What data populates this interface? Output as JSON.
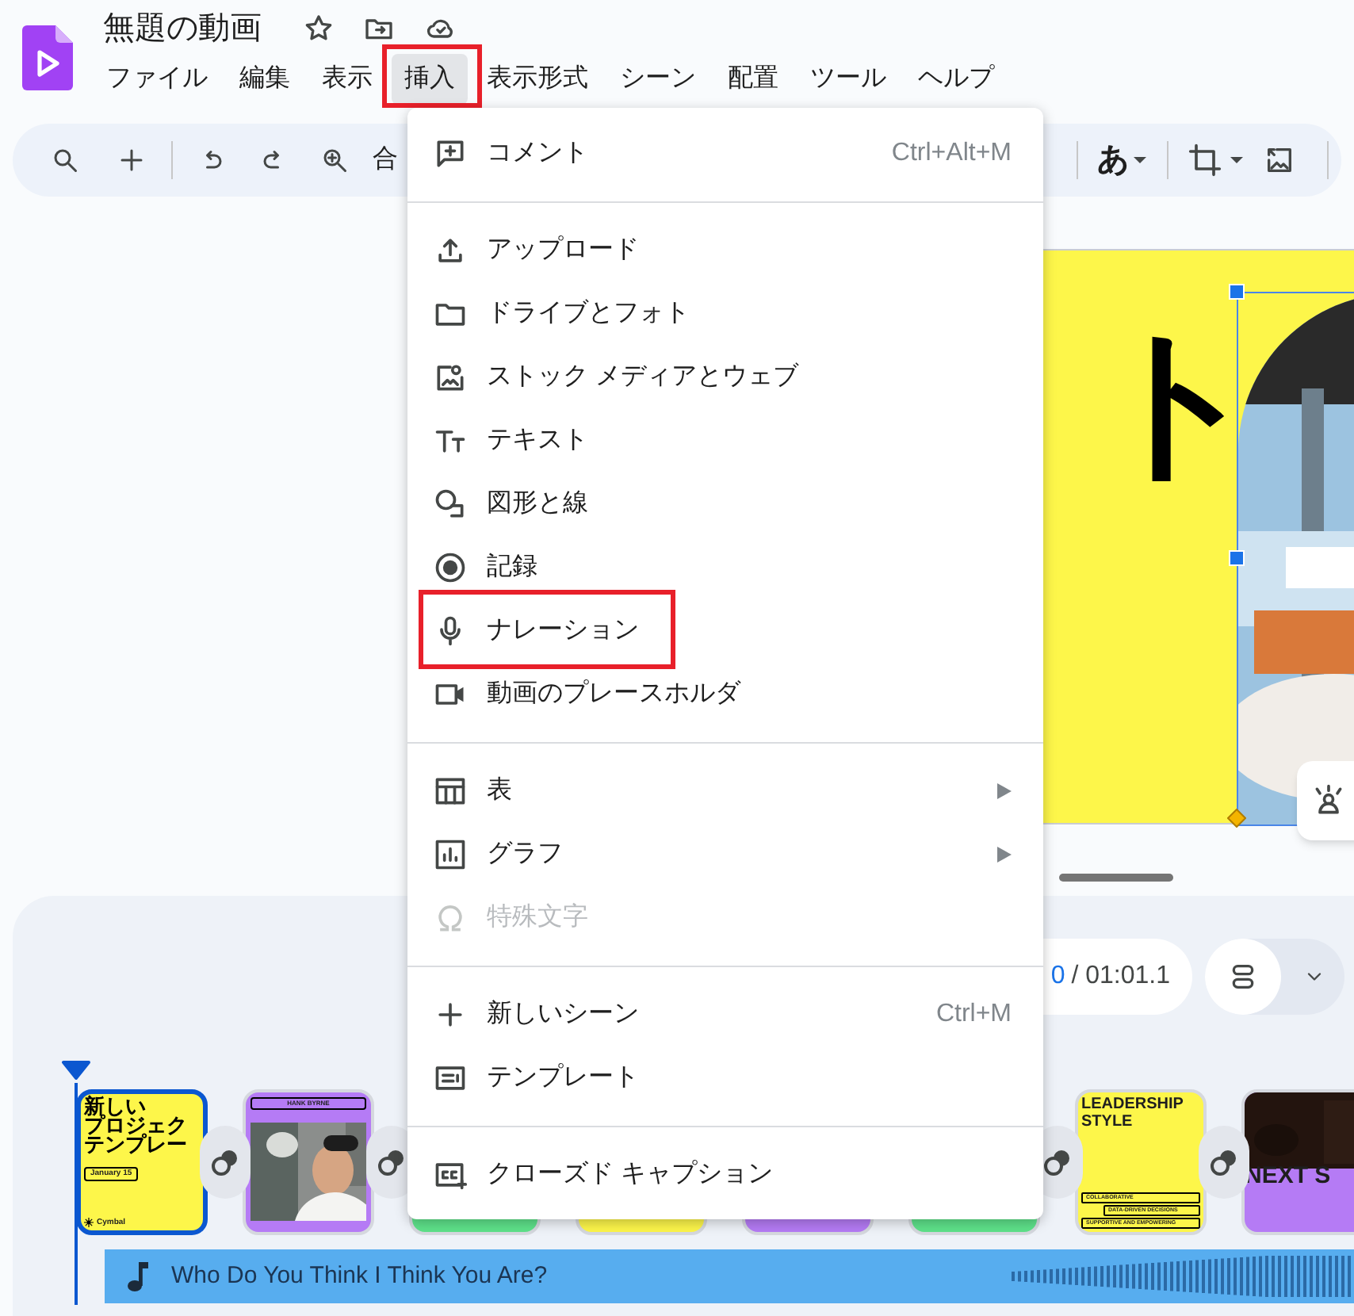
{
  "app": {
    "title": "無題の動画"
  },
  "menu_bar": [
    {
      "label": "ファイル",
      "selected": false,
      "highlighted": false
    },
    {
      "label": "編集",
      "selected": false,
      "highlighted": false
    },
    {
      "label": "表示",
      "selected": false,
      "highlighted": false
    },
    {
      "label": "挿入",
      "selected": true,
      "highlighted": true
    },
    {
      "label": "表示形式",
      "selected": false,
      "highlighted": false
    },
    {
      "label": "シーン",
      "selected": false,
      "highlighted": false
    },
    {
      "label": "配置",
      "selected": false,
      "highlighted": false
    },
    {
      "label": "ツール",
      "selected": false,
      "highlighted": false
    },
    {
      "label": "ヘルプ",
      "selected": false,
      "highlighted": false
    }
  ],
  "toolbar": {
    "text_tool": "合",
    "input_tool": "あ"
  },
  "insert_menu": {
    "groups": [
      {
        "items": [
          {
            "label": "コメント",
            "shortcut": "Ctrl+Alt+M",
            "submenu": false,
            "disabled": false,
            "highlighted": false
          }
        ]
      },
      {
        "items": [
          {
            "label": "アップロード",
            "submenu": false,
            "disabled": false,
            "highlighted": false
          },
          {
            "label": "ドライブとフォト",
            "submenu": false,
            "disabled": false,
            "highlighted": false
          },
          {
            "label": "ストック メディアとウェブ",
            "submenu": false,
            "disabled": false,
            "highlighted": false
          },
          {
            "label": "テキスト",
            "submenu": false,
            "disabled": false,
            "highlighted": false
          },
          {
            "label": "図形と線",
            "submenu": false,
            "disabled": false,
            "highlighted": false
          },
          {
            "label": "記録",
            "submenu": false,
            "disabled": false,
            "highlighted": false
          },
          {
            "label": "ナレーション",
            "submenu": false,
            "disabled": false,
            "highlighted": true
          },
          {
            "label": "動画のプレースホルダ",
            "submenu": false,
            "disabled": false,
            "highlighted": false
          }
        ]
      },
      {
        "items": [
          {
            "label": "表",
            "submenu": true,
            "disabled": false,
            "highlighted": false
          },
          {
            "label": "グラフ",
            "submenu": true,
            "disabled": false,
            "highlighted": false
          },
          {
            "label": "特殊文字",
            "submenu": false,
            "disabled": true,
            "highlighted": false
          }
        ]
      },
      {
        "items": [
          {
            "label": "新しいシーン",
            "shortcut": "Ctrl+M",
            "submenu": false,
            "disabled": false,
            "highlighted": false
          },
          {
            "label": "テンプレート",
            "submenu": false,
            "disabled": false,
            "highlighted": false
          }
        ]
      },
      {
        "items": [
          {
            "label": "クローズド キャプション",
            "submenu": false,
            "disabled": false,
            "highlighted": false
          }
        ]
      }
    ]
  },
  "slide": {
    "heading": "ト"
  },
  "timeline": {
    "view_button_selected": true,
    "time_current": "0",
    "time_total": "/ 01:01.1",
    "scenes": [
      {
        "kind": "title",
        "selected": true,
        "lines": [
          "新しい",
          "プロジェク",
          "テンプレー"
        ],
        "date": "January 15",
        "brand": "Cymbal"
      },
      {
        "selected": false,
        "name": "HANK BYRNE"
      },
      {
        "kind": "covered",
        "selected": false,
        "color": "#5ee28a"
      },
      {
        "kind": "covered",
        "selected": false,
        "color": "#fdf64a"
      },
      {
        "kind": "covered",
        "selected": false,
        "color": "#b57bf5"
      },
      {
        "kind": "covered",
        "selected": false,
        "color": "#5ee28a"
      },
      {
        "kind": "list",
        "selected": false,
        "title": "LEADERSHIP STYLE",
        "points": [
          "COLLABORATIVE",
          "DATA-DRIVEN DECISIONS",
          "SUPPORTIVE AND EMPOWERING"
        ]
      },
      {
        "kind": "closing",
        "selected": false,
        "title": "NEXT S"
      }
    ],
    "audio": {
      "title": "Who Do You Think I Think You Are?"
    }
  }
}
